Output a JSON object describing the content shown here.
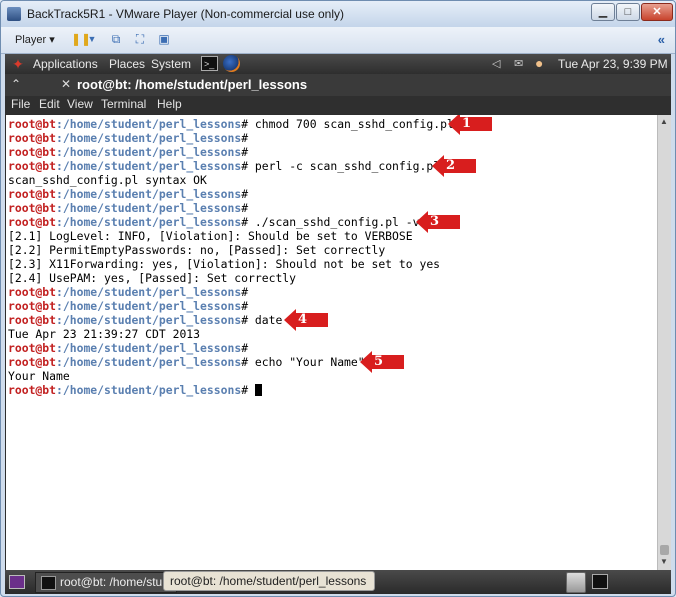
{
  "window": {
    "title": "BackTrack5R1 - VMware Player (Non-commercial use only)"
  },
  "toolbar": {
    "player_label": "Player ▾"
  },
  "panel": {
    "applications": "Applications",
    "places": "Places",
    "system": "System",
    "clock": "Tue Apr 23,  9:39 PM"
  },
  "terminal": {
    "tab_title": "root@bt: /home/student/perl_lessons",
    "menu": [
      "File",
      "Edit",
      "View",
      "Terminal",
      "Help"
    ],
    "prompt_user": "root@bt",
    "prompt_path": ":/home/student/perl_lessons",
    "prompt_suffix": "# ",
    "lines": [
      {
        "prompt": true,
        "text": "chmod 700 scan_sshd_config.pl"
      },
      {
        "prompt": true,
        "text": ""
      },
      {
        "prompt": true,
        "text": ""
      },
      {
        "prompt": true,
        "text": "perl -c scan_sshd_config.pl"
      },
      {
        "prompt": false,
        "text": "scan_sshd_config.pl syntax OK"
      },
      {
        "prompt": true,
        "text": ""
      },
      {
        "prompt": true,
        "text": ""
      },
      {
        "prompt": true,
        "text": "./scan_sshd_config.pl -v"
      },
      {
        "prompt": false,
        "text": "[2.1] LogLevel: INFO, [Violation]: Should be set to VERBOSE"
      },
      {
        "prompt": false,
        "text": "[2.2] PermitEmptyPasswords: no, [Passed]: Set correctly"
      },
      {
        "prompt": false,
        "text": "[2.3] X11Forwarding: yes, [Violation]: Should not be set to yes"
      },
      {
        "prompt": false,
        "text": "[2.4] UsePAM: yes, [Passed]: Set correctly"
      },
      {
        "prompt": true,
        "text": ""
      },
      {
        "prompt": true,
        "text": ""
      },
      {
        "prompt": true,
        "text": "date"
      },
      {
        "prompt": false,
        "text": "Tue Apr 23 21:39:27 CDT 2013"
      },
      {
        "prompt": true,
        "text": ""
      },
      {
        "prompt": true,
        "text": "echo \"Your Name\""
      },
      {
        "prompt": false,
        "text": "Your Name"
      },
      {
        "prompt": true,
        "text": "",
        "cursor": true
      }
    ]
  },
  "annotations": [
    "1",
    "2",
    "3",
    "4",
    "5"
  ],
  "taskbar": {
    "task1": "root@bt: /home/stu",
    "task2": "root@bt: /home/student/perl_lessons"
  },
  "colors": {
    "prompt_user": "#c22020",
    "prompt_path": "#5a7fb0",
    "arrow": "#d81e1e"
  }
}
